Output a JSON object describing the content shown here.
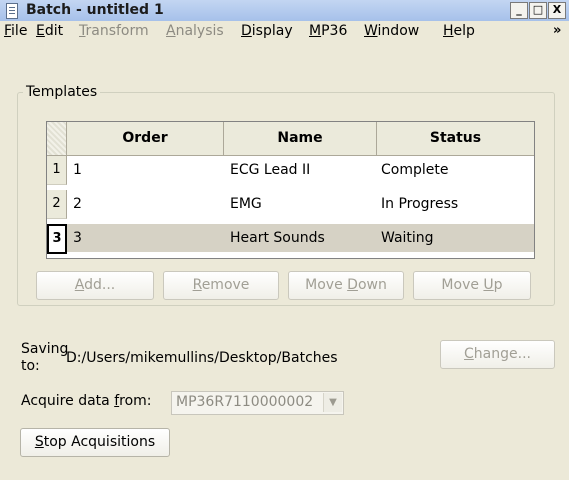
{
  "window": {
    "title": "Batch - untitled 1",
    "minimize": "_",
    "maximize": "□",
    "close": "X"
  },
  "menu": [
    {
      "label": "File",
      "key": "F",
      "rest": "ile",
      "enabled": true
    },
    {
      "label": "Edit",
      "key": "E",
      "rest": "dit",
      "enabled": true
    },
    {
      "label": "Transform",
      "key": "T",
      "rest": "ransform",
      "enabled": false
    },
    {
      "label": "Analysis",
      "key": "A",
      "rest": "nalysis",
      "enabled": false
    },
    {
      "label": "Display",
      "key": "D",
      "rest": "isplay",
      "enabled": true
    },
    {
      "label": "MP36",
      "key": "M",
      "rest": "P36",
      "enabled": true
    },
    {
      "label": "Window",
      "key": "W",
      "rest": "indow",
      "enabled": true
    },
    {
      "label": "Help",
      "key": "H",
      "rest": "elp",
      "enabled": true
    }
  ],
  "menu_overflow": "»",
  "templates": {
    "group_label": "Templates",
    "columns": [
      "Order",
      "Name",
      "Status"
    ],
    "rows": [
      {
        "row_number": "1",
        "order": "1",
        "name": "ECG Lead II",
        "status": "Complete"
      },
      {
        "row_number": "2",
        "order": "2",
        "name": "EMG",
        "status": "In Progress"
      },
      {
        "row_number": "3",
        "order": "3",
        "name": "Heart Sounds",
        "status": "Waiting"
      }
    ],
    "buttons": {
      "add": {
        "key": "A",
        "rest": "dd..."
      },
      "remove": {
        "key": "R",
        "rest": "emove"
      },
      "move_down_pre": "Move ",
      "move_down_key": "D",
      "move_down_rest": "own",
      "move_up_pre": "Move ",
      "move_up_key": "U",
      "move_up_rest": "p"
    }
  },
  "saving": {
    "label_line1": "Saving",
    "label_line2": "to:",
    "path": "D:/Users/mikemullins/Desktop/Batches",
    "change_key": "C",
    "change_rest": "hange..."
  },
  "acquire": {
    "label_pre": "Acquire data ",
    "label_key": "f",
    "label_rest": "rom:",
    "value": "MP36R7110000002"
  },
  "stop": {
    "key": "S",
    "rest": "top Acquisitions"
  }
}
